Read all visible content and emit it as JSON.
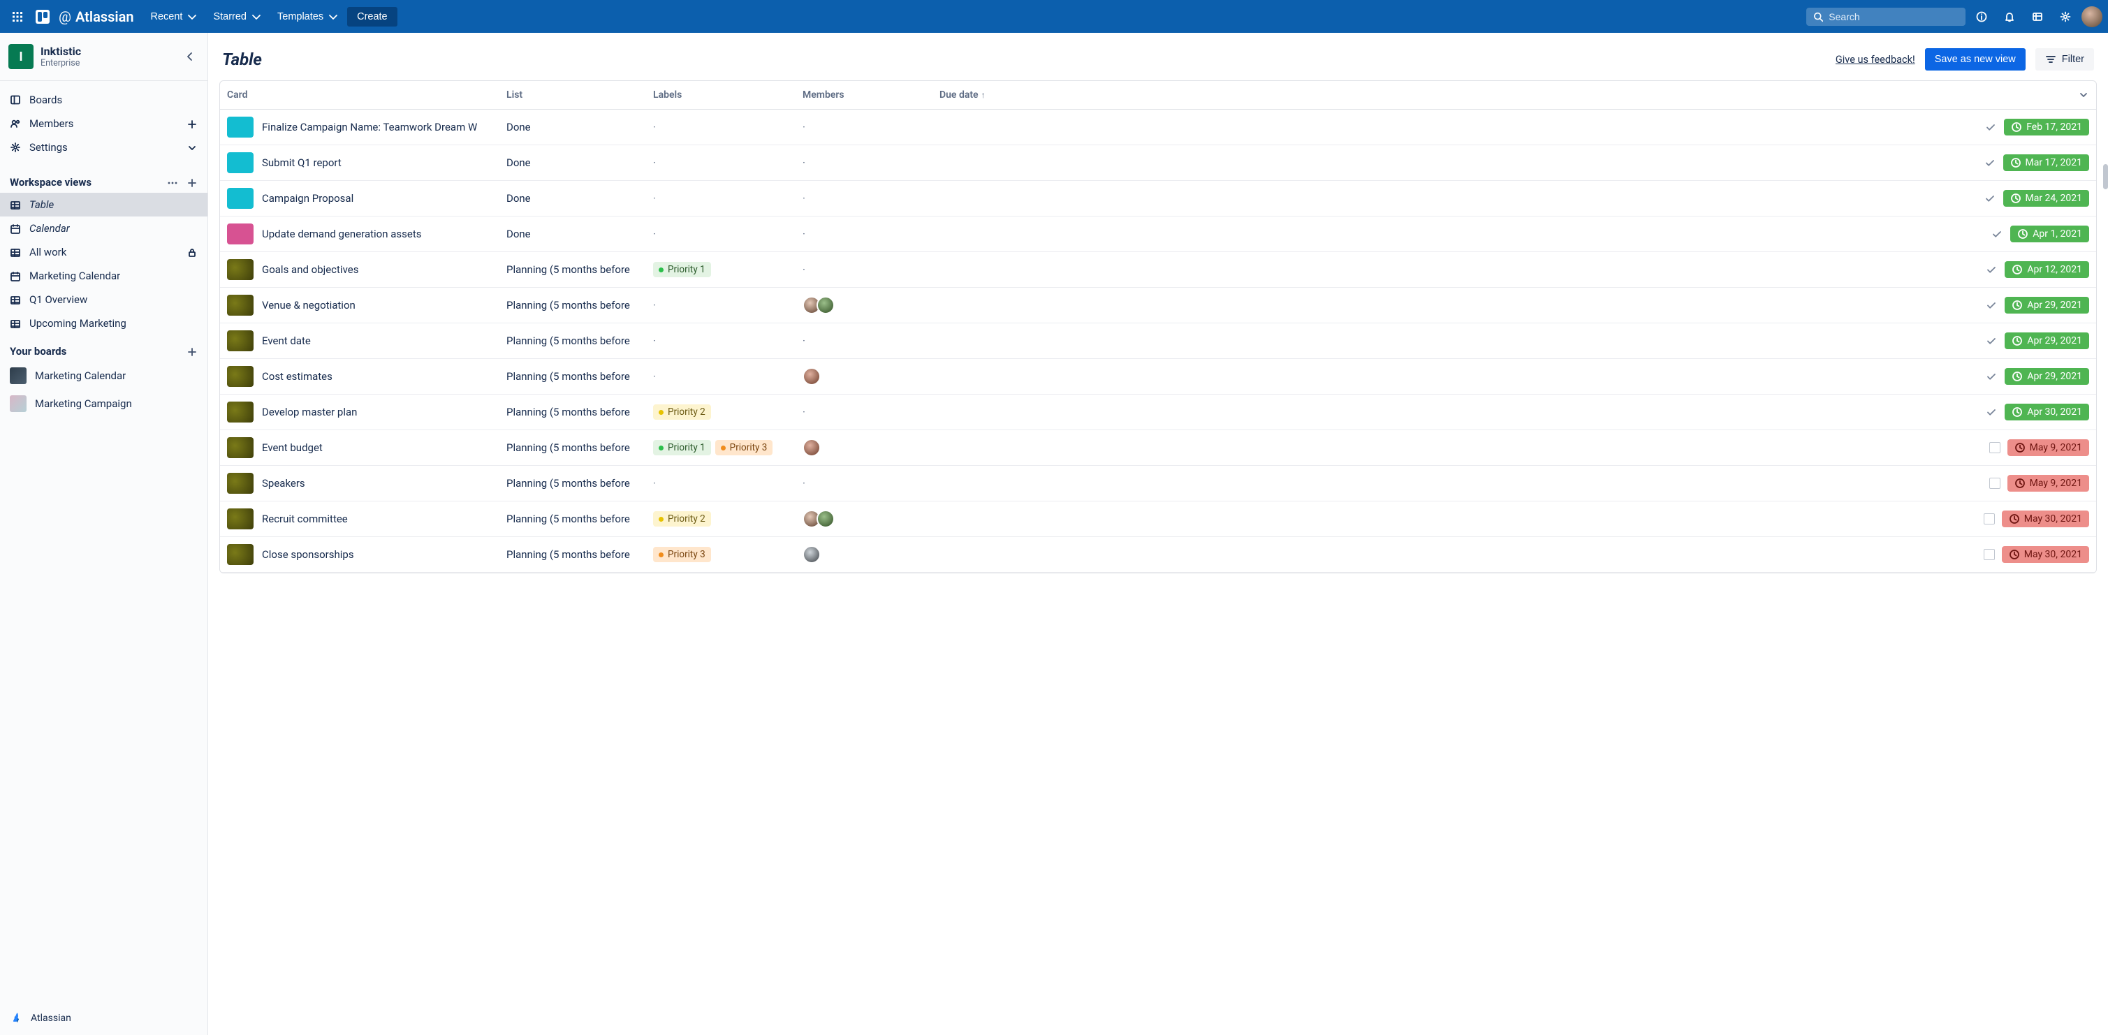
{
  "topbar": {
    "brand_at": "@",
    "brand_name": "Atlassian",
    "nav": {
      "recent": "Recent",
      "starred": "Starred",
      "templates": "Templates"
    },
    "create": "Create",
    "search_placeholder": "Search"
  },
  "workspace": {
    "initial": "I",
    "name": "Inktistic",
    "tier": "Enterprise"
  },
  "sidebar": {
    "primary": {
      "boards": "Boards",
      "members": "Members",
      "settings": "Settings"
    },
    "views_header": "Workspace views",
    "views": [
      {
        "label": "Table",
        "icon": "table",
        "active": true,
        "italic": true
      },
      {
        "label": "Calendar",
        "icon": "calendar",
        "italic": true
      },
      {
        "label": "All work",
        "icon": "table",
        "locked": true
      },
      {
        "label": "Marketing Calendar",
        "icon": "calendar"
      },
      {
        "label": "Q1 Overview",
        "icon": "table"
      },
      {
        "label": "Upcoming Marketing",
        "icon": "table"
      }
    ],
    "boards_header": "Your boards",
    "boards": [
      {
        "label": "Marketing Calendar",
        "tile": "linear-gradient(135deg,#2e3d4b,#4c5e6e)"
      },
      {
        "label": "Marketing Campaign",
        "tile": "linear-gradient(135deg,#d7b7c7,#b6d0d6)"
      }
    ],
    "footer": "Atlassian"
  },
  "page": {
    "title": "Table",
    "feedback": "Give us feedback!",
    "save_view": "Save as new view",
    "filter": "Filter"
  },
  "table": {
    "columns": {
      "card": "Card",
      "list": "List",
      "labels": "Labels",
      "members": "Members",
      "due": "Due date"
    },
    "sort_indicator": "↑",
    "rows": [
      {
        "swatch": "cyan",
        "card": "Finalize Campaign Name: Teamwork Dream W",
        "list": "Done",
        "labels": [],
        "members": [],
        "check": "done",
        "due": "Feb 17, 2021",
        "due_color": "green"
      },
      {
        "swatch": "cyan",
        "card": "Submit Q1 report",
        "list": "Done",
        "labels": [],
        "members": [],
        "check": "done",
        "due": "Mar 17, 2021",
        "due_color": "green"
      },
      {
        "swatch": "cyan",
        "card": "Campaign Proposal",
        "list": "Done",
        "labels": [],
        "members": [],
        "check": "done",
        "due": "Mar 24, 2021",
        "due_color": "green"
      },
      {
        "swatch": "pink",
        "card": "Update demand generation assets",
        "list": "Done",
        "labels": [],
        "members": [],
        "check": "done",
        "due": "Apr 1, 2021",
        "due_color": "green"
      },
      {
        "swatch": "yellow",
        "card": "Goals and objectives",
        "list": "Planning (5 months before",
        "labels": [
          "p1"
        ],
        "members": [],
        "check": "done",
        "due": "Apr 12, 2021",
        "due_color": "green"
      },
      {
        "swatch": "yellow",
        "card": "Venue & negotiation",
        "list": "Planning (5 months before",
        "labels": [],
        "members": [
          "a1",
          "a2"
        ],
        "check": "done",
        "due": "Apr 29, 2021",
        "due_color": "green"
      },
      {
        "swatch": "yellow",
        "card": "Event date",
        "list": "Planning (5 months before",
        "labels": [],
        "members": [],
        "check": "done",
        "due": "Apr 29, 2021",
        "due_color": "green"
      },
      {
        "swatch": "yellow",
        "card": "Cost estimates",
        "list": "Planning (5 months before",
        "labels": [],
        "members": [
          "a3"
        ],
        "check": "done",
        "due": "Apr 29, 2021",
        "due_color": "green"
      },
      {
        "swatch": "yellow",
        "card": "Develop master plan",
        "list": "Planning (5 months before",
        "labels": [
          "p2"
        ],
        "members": [],
        "check": "done",
        "due": "Apr 30, 2021",
        "due_color": "green"
      },
      {
        "swatch": "yellow",
        "card": "Event budget",
        "list": "Planning (5 months before",
        "labels": [
          "p1",
          "p3"
        ],
        "members": [
          "a3"
        ],
        "check": "box",
        "due": "May 9, 2021",
        "due_color": "red"
      },
      {
        "swatch": "yellow",
        "card": "Speakers",
        "list": "Planning (5 months before",
        "labels": [],
        "members": [],
        "check": "box",
        "due": "May 9, 2021",
        "due_color": "red"
      },
      {
        "swatch": "yellow",
        "card": "Recruit committee",
        "list": "Planning (5 months before",
        "labels": [
          "p2"
        ],
        "members": [
          "a1",
          "a2"
        ],
        "check": "box",
        "due": "May 30, 2021",
        "due_color": "red"
      },
      {
        "swatch": "yellow",
        "card": "Close sponsorships",
        "list": "Planning (5 months before",
        "labels": [
          "p3"
        ],
        "members": [
          "a4"
        ],
        "check": "box",
        "due": "May 30, 2021",
        "due_color": "red"
      }
    ]
  },
  "label_text": {
    "p1": "Priority 1",
    "p2": "Priority 2",
    "p3": "Priority 3"
  }
}
